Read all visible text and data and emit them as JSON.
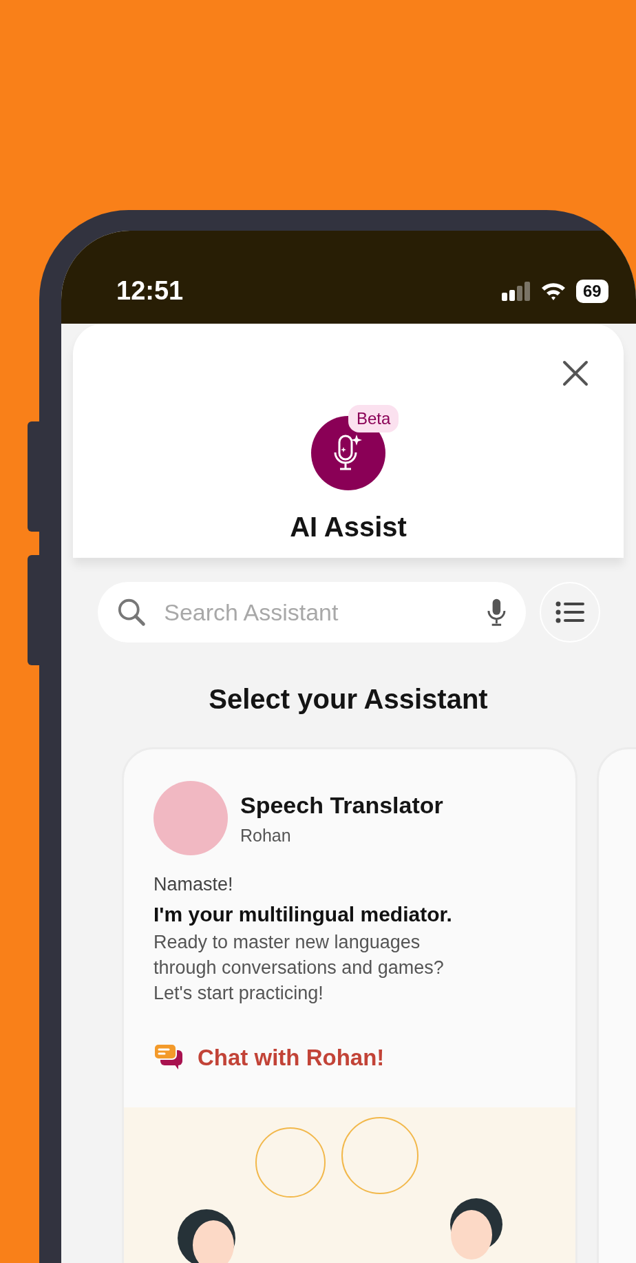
{
  "status_bar": {
    "time": "12:51",
    "battery": "69"
  },
  "sheet": {
    "badge": "Beta",
    "title": "AI Assist"
  },
  "search": {
    "placeholder": "Search Assistant"
  },
  "heading": "Select your Assistant",
  "cards": [
    {
      "title": "Speech Translator",
      "subtitle": "Rohan",
      "greeting": "Namaste!",
      "tagline": "I'm your multilingual mediator.",
      "description": "Ready to master new languages through conversations and games? Let's start practicing!",
      "cta": "Chat with Rohan!"
    }
  ]
}
